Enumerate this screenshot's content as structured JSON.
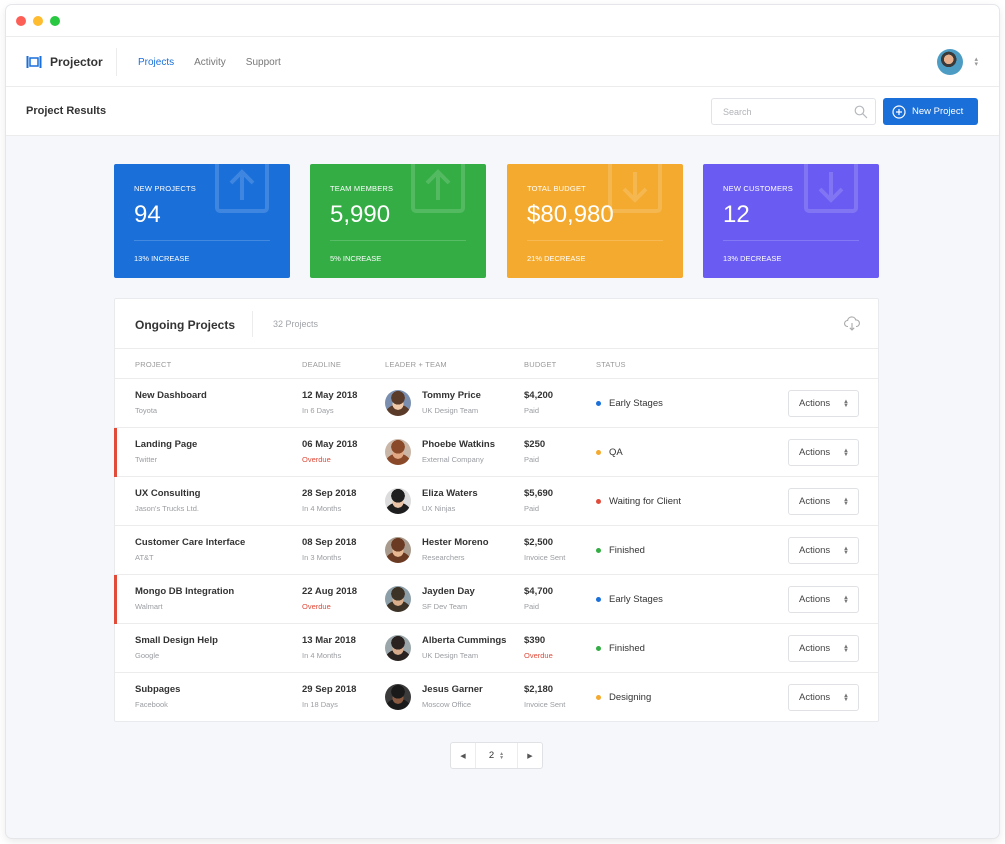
{
  "nav": {
    "brand": "Projector",
    "links": [
      {
        "label": "Projects",
        "active": true
      },
      {
        "label": "Activity",
        "active": false
      },
      {
        "label": "Support",
        "active": false
      }
    ]
  },
  "subheader": {
    "title": "Project Results",
    "search_placeholder": "Search",
    "new_button": "New Project"
  },
  "cards": [
    {
      "label": "NEW PROJECTS",
      "value": "94",
      "foot": "13% INCREASE",
      "color": "#1a6fd9",
      "icon": "arrow-up-icon"
    },
    {
      "label": "TEAM MEMBERS",
      "value": "5,990",
      "foot": "5% INCREASE",
      "color": "#34ad45",
      "icon": "arrow-up-icon"
    },
    {
      "label": "TOTAL BUDGET",
      "value": "$80,980",
      "foot": "21% DECREASE",
      "color": "#f4aa2e",
      "icon": "arrow-down-icon"
    },
    {
      "label": "NEW CUSTOMERS",
      "value": "12",
      "foot": "13% DECREASE",
      "color": "#6a5bf2",
      "icon": "arrow-down-icon"
    }
  ],
  "panel": {
    "title": "Ongoing Projects",
    "count": "32 Projects",
    "columns": [
      "PROJECT",
      "DEADLINE",
      "LEADER + TEAM",
      "BUDGET",
      "STATUS"
    ],
    "actions_label": "Actions",
    "rows": [
      {
        "project": "New Dashboard",
        "client": "Toyota",
        "deadline": "12 May 2018",
        "deadline_note": "In 6 Days",
        "overdue": false,
        "leader": "Tommy Price",
        "team": "UK Design Team",
        "budget": "$4,200",
        "budget_note": "Paid",
        "budget_overdue": false,
        "status": "Early Stages",
        "status_color": "#1a6fd9",
        "flag": false
      },
      {
        "project": "Landing Page",
        "client": "Twitter",
        "deadline": "06 May 2018",
        "deadline_note": "Overdue",
        "overdue": true,
        "leader": "Phoebe Watkins",
        "team": "External Company",
        "budget": "$250",
        "budget_note": "Paid",
        "budget_overdue": false,
        "status": "QA",
        "status_color": "#f4aa2e",
        "flag": true
      },
      {
        "project": "UX Consulting",
        "client": "Jason's Trucks Ltd.",
        "deadline": "28 Sep 2018",
        "deadline_note": "In 4 Months",
        "overdue": false,
        "leader": "Eliza Waters",
        "team": "UX Ninjas",
        "budget": "$5,690",
        "budget_note": "Paid",
        "budget_overdue": false,
        "status": "Waiting for Client",
        "status_color": "#e04b3a",
        "flag": false
      },
      {
        "project": "Customer Care Interface",
        "client": "AT&T",
        "deadline": "08 Sep 2018",
        "deadline_note": "In 3 Months",
        "overdue": false,
        "leader": "Hester Moreno",
        "team": "Researchers",
        "budget": "$2,500",
        "budget_note": "Invoice Sent",
        "budget_overdue": false,
        "status": "Finished",
        "status_color": "#34ad45",
        "flag": false
      },
      {
        "project": "Mongo DB Integration",
        "client": "Walmart",
        "deadline": "22 Aug 2018",
        "deadline_note": "Overdue",
        "overdue": true,
        "leader": "Jayden Day",
        "team": "SF Dev Team",
        "budget": "$4,700",
        "budget_note": "Paid",
        "budget_overdue": false,
        "status": "Early Stages",
        "status_color": "#1a6fd9",
        "flag": true
      },
      {
        "project": "Small Design Help",
        "client": "Google",
        "deadline": "13 Mar 2018",
        "deadline_note": "In 4 Months",
        "overdue": false,
        "leader": "Alberta Cummings",
        "team": "UK Design Team",
        "budget": "$390",
        "budget_note": "Overdue",
        "budget_overdue": true,
        "status": "Finished",
        "status_color": "#34ad45",
        "flag": false
      },
      {
        "project": "Subpages",
        "client": "Facebook",
        "deadline": "29 Sep 2018",
        "deadline_note": "In 18 Days",
        "overdue": false,
        "leader": "Jesus Garner",
        "team": "Moscow Office",
        "budget": "$2,180",
        "budget_note": "Invoice Sent",
        "budget_overdue": false,
        "status": "Designing",
        "status_color": "#f4aa2e",
        "flag": false
      }
    ]
  },
  "pager": {
    "page": "2"
  }
}
